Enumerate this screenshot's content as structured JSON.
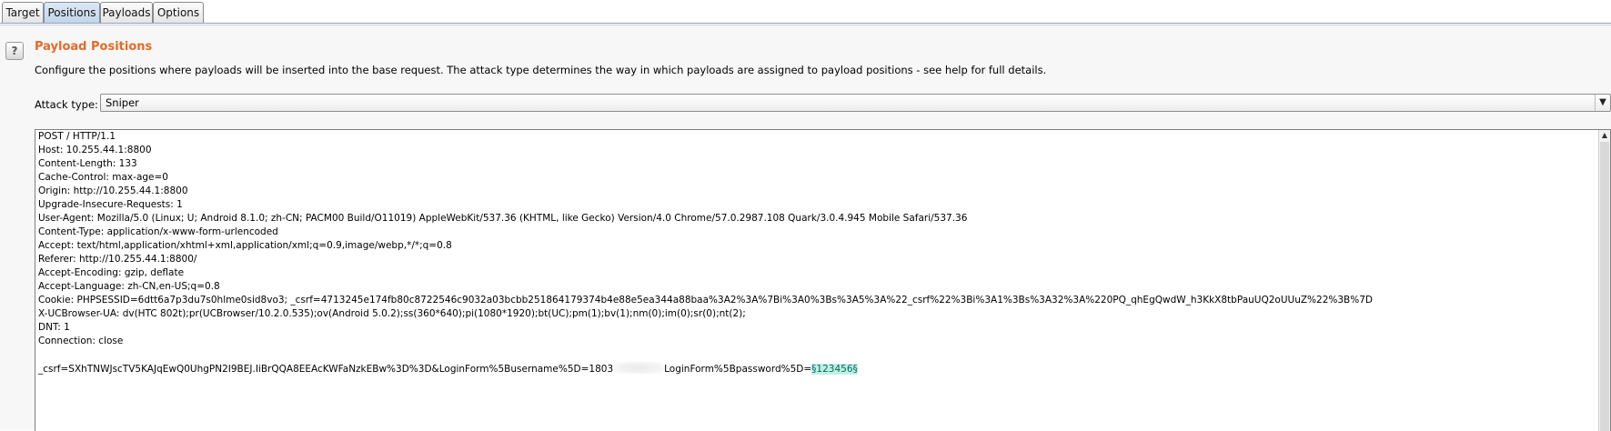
{
  "tabs": [
    {
      "label": "Target",
      "active": false
    },
    {
      "label": "Positions",
      "active": true
    },
    {
      "label": "Payloads",
      "active": false
    },
    {
      "label": "Options",
      "active": false
    }
  ],
  "section": {
    "help_icon": "?",
    "title": "Payload Positions",
    "description": "Configure the positions where payloads will be inserted into the base request. The attack type determines the way in which payloads are assigned to payload positions - see help for full details."
  },
  "attack": {
    "label": "Attack type:",
    "value": "Sniper",
    "arrow_icon": "▼"
  },
  "request": {
    "lines": [
      "POST / HTTP/1.1",
      "Host: 10.255.44.1:8800",
      "Content-Length: 133",
      "Cache-Control: max-age=0",
      "Origin: http://10.255.44.1:8800",
      "Upgrade-Insecure-Requests: 1",
      "User-Agent: Mozilla/5.0 (Linux; U; Android 8.1.0; zh-CN; PACM00 Build/O11019) AppleWebKit/537.36 (KHTML, like Gecko) Version/4.0 Chrome/57.0.2987.108 Quark/3.0.4.945 Mobile Safari/537.36",
      "Content-Type: application/x-www-form-urlencoded",
      "Accept: text/html,application/xhtml+xml,application/xml;q=0.9,image/webp,*/*;q=0.8",
      "Referer: http://10.255.44.1:8800/",
      "Accept-Encoding: gzip, deflate",
      "Accept-Language: zh-CN,en-US;q=0.8",
      "Cookie: PHPSESSID=6dtt6a7p3du7s0hlme0sid8vo3; _csrf=4713245e174fb80c8722546c9032a03bcbb251864179374b4e88e5ea344a88baa%3A2%3A%7Bi%3A0%3Bs%3A5%3A%22_csrf%22%3Bi%3A1%3Bs%3A32%3A%220PQ_qhEgQwdW_h3KkX8tbPauUQ2oUUuZ%22%3B%7D",
      "X-UCBrowser-UA: dv(HTC 802t);pr(UCBrowser/10.2.0.535);ov(Android 5.0.2);ss(360*640);pi(1080*1920);bt(UC);pm(1);bv(1);nm(0);im(0);sr(0);nt(2);",
      "DNT: 1",
      "Connection: close",
      ""
    ],
    "body_prefix": "_csrf=SXhTNWJscTV5KAJqEwQ0UhgPN2I9BEJ.IiBrQQA8EEAcKWFaNzkEBw%3D%3D&LoginForm%5Busername%5D=1803",
    "body_middle": "LoginForm%5Bpassword%5D=",
    "body_payload": "§123456§"
  },
  "scroll_up_icon": "▲"
}
